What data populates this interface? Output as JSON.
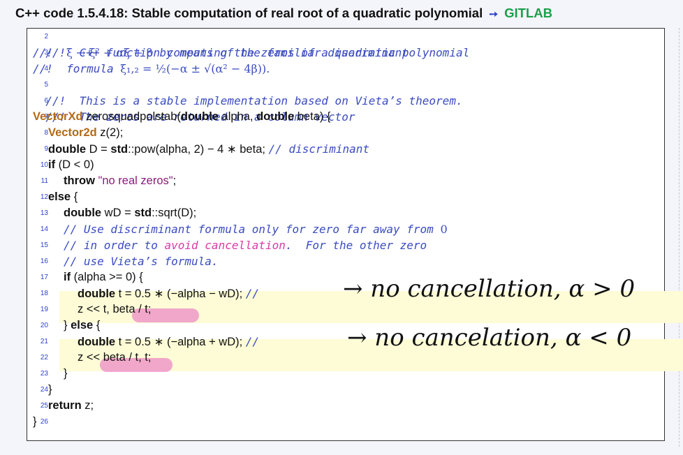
{
  "header": {
    "title": "C++ code 1.5.4.18: Stable computation of real root of a quadratic polynomial",
    "arrow": "➙",
    "link": "GITLAB"
  },
  "code": {
    "line_numbers": [
      "2",
      "3",
      "4",
      "5",
      "6",
      "7",
      "8",
      "9",
      "10",
      "11",
      "12",
      "13",
      "14",
      "15",
      "16",
      "17",
      "18",
      "19",
      "20",
      "21",
      "22",
      "23",
      "24",
      "25",
      "26"
    ],
    "l2": "//!  C++ function computing the zeros of a quadratic polynomial",
    "l3_a": "//!  ",
    "l3_math": "ξ → ξ² + αξ + β",
    "l3_b": " by means of the familiar discriminant",
    "l4_a": "//!  formula ",
    "l4_math": "ξ₁,₂ = ½(−α ± √(α² − 4β)).",
    "l5": "//!  This is a stable implementation based on Vieta’s theorem.",
    "l6": "//!  The zeros are returned in a column vector",
    "l7_type": "VectorXd",
    "l7_name": " zerosquadpolstab(",
    "l7_kw1": "double",
    "l7_mid": " alpha, ",
    "l7_kw2": "double",
    "l7_end": " beta) {",
    "l8_type": "Vector2d",
    "l8_rest": " z(2);",
    "l9_kw": "double",
    "l9_a": " D = ",
    "l9_std": "std",
    "l9_b": "::pow(alpha, 2) − 4 ∗ beta; ",
    "l9_cm": "// discriminant",
    "l10_kw": "if",
    "l10_rest": " (D < 0)",
    "l11_kw": "throw",
    "l11_str": " \"no real zeros\"",
    "l11_end": ";",
    "l12_kw": "else",
    "l12_rest": " {",
    "l13_kw": "double",
    "l13_a": " wD = ",
    "l13_std": "std",
    "l13_b": "::sqrt(D);",
    "l14_cm": "// Use discriminant formula only for zero far away from ",
    "l14_zero": "0",
    "l15_cm1": "// in order to ",
    "l15_pink": "avoid cancellation",
    "l15_cm2": ".  For the other zero",
    "l16_cm": "// use Vieta’s formula.",
    "l17_kw": "if",
    "l17_rest": " (alpha >= 0) {",
    "l18_kw": "double",
    "l18_rest": " t = 0.5 ∗ (−alpha − wD); ",
    "l18_cm": "//",
    "l19": "z << t, beta / t;",
    "l20_a": "} ",
    "l20_kw": "else",
    "l20_b": " {",
    "l21_kw": "double",
    "l21_rest": " t = 0.5 ∗ (−alpha + wD); ",
    "l21_cm": "//",
    "l22": "z << beta / t, t;",
    "l23": "}",
    "l24": "}",
    "l25_kw": "return",
    "l25_rest": " z;",
    "l26": "}"
  },
  "annotations": {
    "note1": "→ no cancellation, α > 0",
    "note2": "→ no cancelation, α < 0"
  },
  "colors": {
    "highlight": "#fdfcd6",
    "marker": "#e860c0",
    "comment": "#3b4cc0",
    "type": "#b26a16",
    "string": "#8b1a7a",
    "link": "#1aa049"
  }
}
